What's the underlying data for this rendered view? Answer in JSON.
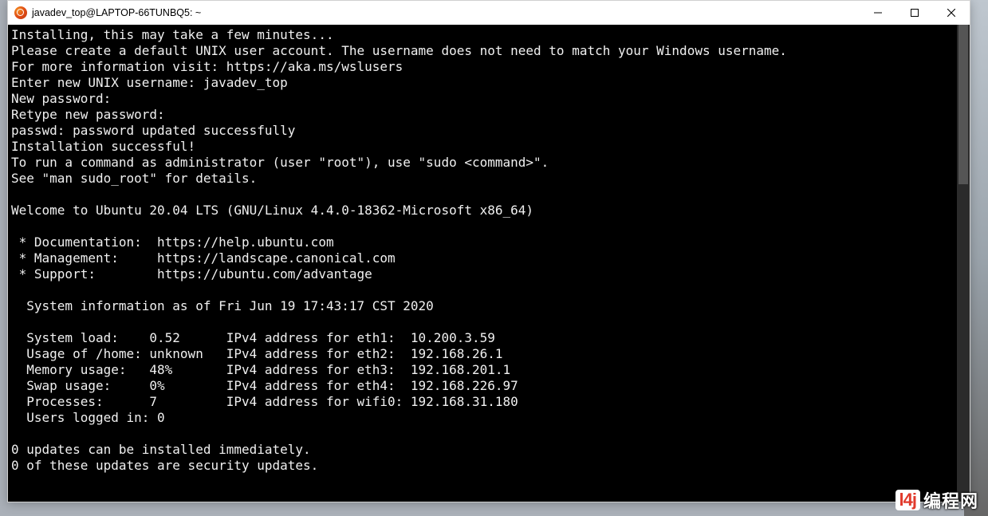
{
  "window": {
    "title": "javadev_top@LAPTOP-66TUNBQ5: ~"
  },
  "terminal": {
    "l01": "Installing, this may take a few minutes...",
    "l02": "Please create a default UNIX user account. The username does not need to match your Windows username.",
    "l03": "For more information visit: https://aka.ms/wslusers",
    "l04": "Enter new UNIX username: javadev_top",
    "l05": "New password:",
    "l06": "Retype new password:",
    "l07": "passwd: password updated successfully",
    "l08": "Installation successful!",
    "l09": "To run a command as administrator (user \"root\"), use \"sudo <command>\".",
    "l10": "See \"man sudo_root\" for details.",
    "l11": "",
    "l12": "Welcome to Ubuntu 20.04 LTS (GNU/Linux 4.4.0-18362-Microsoft x86_64)",
    "l13": "",
    "l14": " * Documentation:  https://help.ubuntu.com",
    "l15": " * Management:     https://landscape.canonical.com",
    "l16": " * Support:        https://ubuntu.com/advantage",
    "l17": "",
    "l18": "  System information as of Fri Jun 19 17:43:17 CST 2020",
    "l19": "",
    "l20": "  System load:    0.52      IPv4 address for eth1:  10.200.3.59",
    "l21": "  Usage of /home: unknown   IPv4 address for eth2:  192.168.26.1",
    "l22": "  Memory usage:   48%       IPv4 address for eth3:  192.168.201.1",
    "l23": "  Swap usage:     0%        IPv4 address for eth4:  192.168.226.97",
    "l24": "  Processes:      7         IPv4 address for wifi0: 192.168.31.180",
    "l25": "  Users logged in: 0",
    "l26": "",
    "l27": "0 updates can be installed immediately.",
    "l28": "0 of these updates are security updates.",
    "l29": ""
  },
  "watermark": {
    "logo": "l4j",
    "text": "编程网"
  }
}
